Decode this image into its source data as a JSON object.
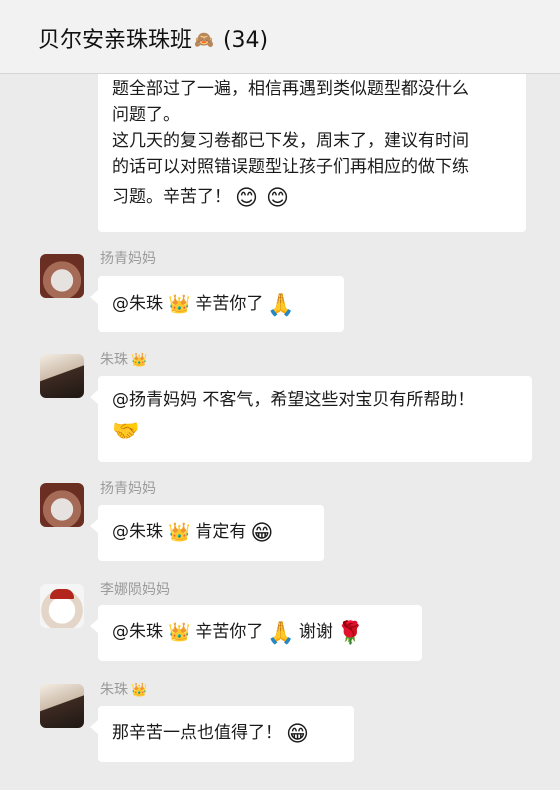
{
  "header": {
    "title": "贝尔安亲珠珠班",
    "title_icon": "🙈",
    "member_count": "(34)"
  },
  "messages": [
    {
      "lines": [
        "题全部过了一遍，相信再遇到类似题型都没什么",
        "问题了。",
        "这几天的复习卷都已下发，周末了，建议有时间",
        "的话可以对照错误题型让孩子们再相应的做下练",
        "习题。辛苦了！"
      ],
      "emojis": [
        "😊",
        "😊"
      ]
    },
    {
      "sender": "扬青妈妈",
      "parts": [
        "@朱珠",
        "👑",
        "辛苦你了",
        "🙏"
      ]
    },
    {
      "sender": "朱珠",
      "sender_badge": "👑",
      "line1": "@扬青妈妈 不客气，希望这些对宝贝有所帮助！",
      "line2_emoji": "🤝"
    },
    {
      "sender": "扬青妈妈",
      "parts": [
        "@朱珠",
        "👑",
        "肯定有",
        "😁"
      ]
    },
    {
      "sender": "李娜陨妈妈",
      "parts": [
        "@朱珠",
        "👑",
        "辛苦你了",
        "🙏",
        "谢谢",
        "🌹"
      ]
    },
    {
      "sender": "朱珠",
      "sender_badge": "👑",
      "parts": [
        "那辛苦一点也值得了！",
        "😁"
      ]
    }
  ]
}
